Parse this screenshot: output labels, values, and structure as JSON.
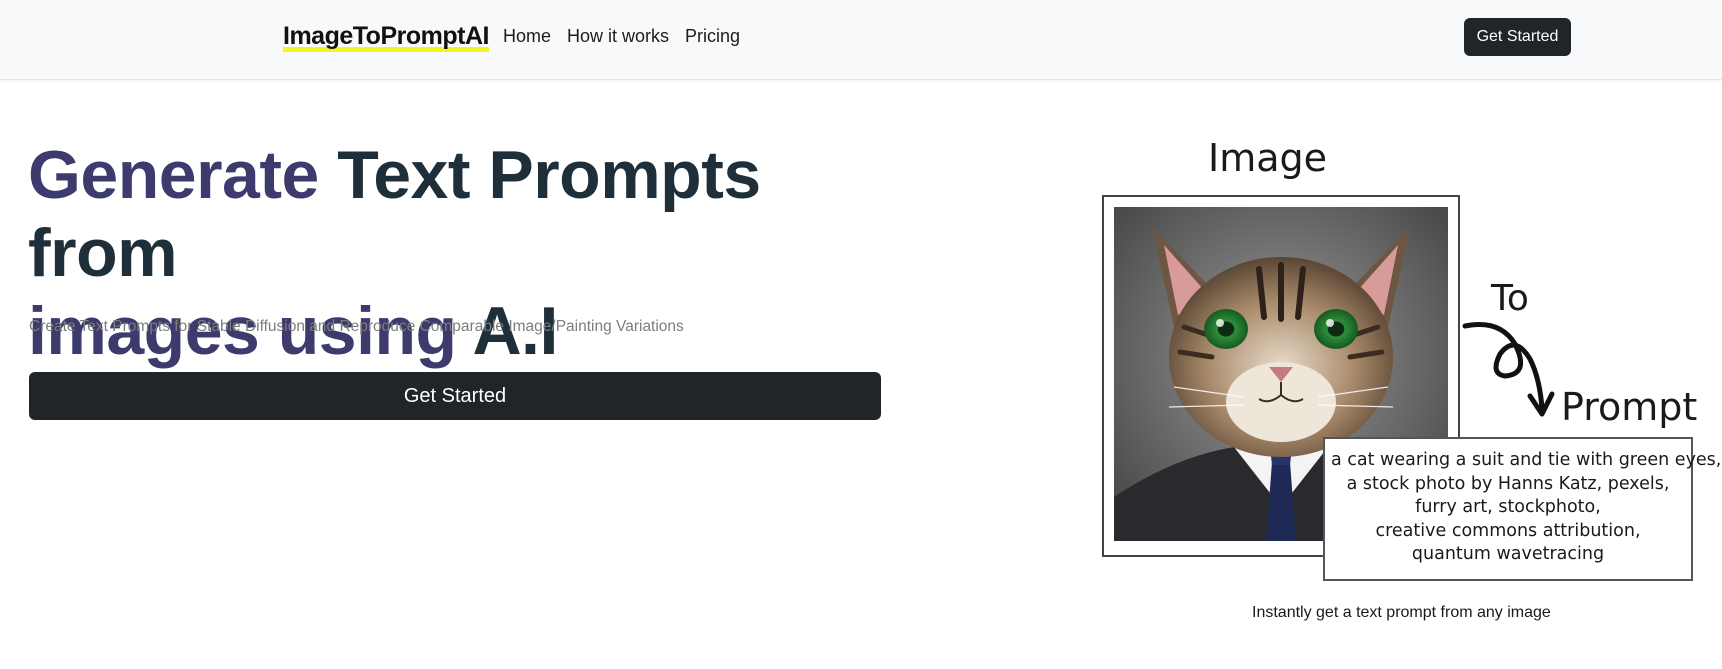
{
  "nav": {
    "brand": "ImageToPromptAI",
    "links": [
      "Home",
      "How it works",
      "Pricing"
    ],
    "cta": "Get Started"
  },
  "hero": {
    "title_part1": "Generate ",
    "title_part2": "Text Prompts from",
    "title_part3": "images using ",
    "title_part4": "A.I",
    "subtitle": "Create Text Prompts for Stable Diffusion and Reproduce Comparable Image/Painting Variations",
    "cta": "Get Started"
  },
  "illustration": {
    "label_image": "Image",
    "label_to": "To",
    "label_prompt": "Prompt",
    "prompt_lines": [
      "a cat wearing a suit and tie with green eyes,",
      "a stock photo by Hanns Katz, pexels,",
      "furry art, stockphoto,",
      "creative commons attribution,",
      "quantum wavetracing"
    ],
    "caption": "Instantly get a text prompt from any image"
  },
  "colors": {
    "nav_bg": "#f8f9fa",
    "button_dark": "#212529",
    "title_purple": "#3d3b6d",
    "title_dark": "#1f2f3a",
    "brand_highlight": "#f3f520"
  }
}
